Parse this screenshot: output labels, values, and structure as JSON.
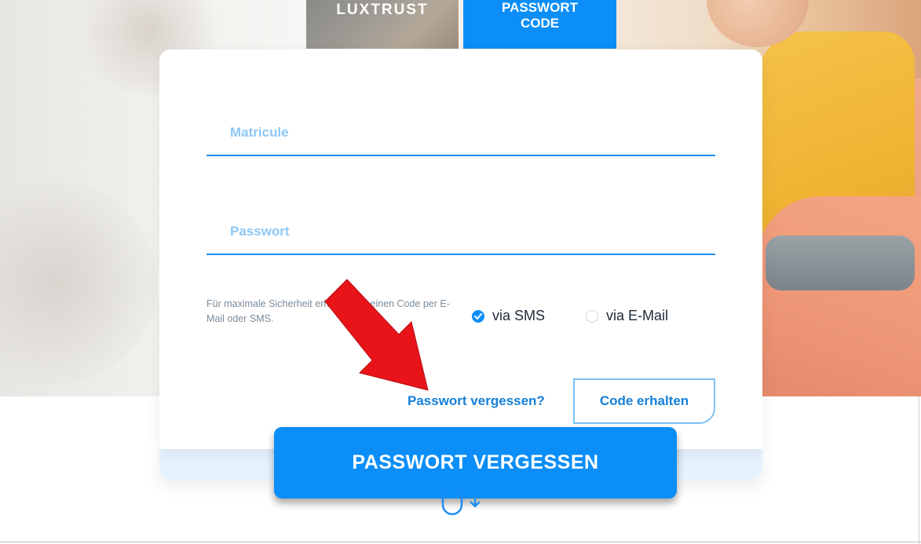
{
  "tabs": {
    "luxtrust_label": "LUXTRUST",
    "passwort_label_line1": "PASSWORT",
    "passwort_label_line2": "CODE"
  },
  "form": {
    "matricule_placeholder": "Matricule",
    "passwort_placeholder": "Passwort",
    "info_text": "Für maximale Sicherheit erhalten Sie einen Code per E-Mail oder SMS.",
    "radio_sms_label": "via SMS",
    "radio_mail_label": "via E-Mail",
    "radio_selected": "via SMS",
    "forgot_link": "Passwort vergessen?",
    "code_button": "Code erhalten"
  },
  "banner": {
    "label": "PASSWORT VERGESSEN"
  },
  "icons": {
    "checked_radio": "checkmark-icon",
    "scroll": "mouse-scroll-icon",
    "annotation": "red-arrow-icon"
  },
  "colors": {
    "primary": "#0b8ef7",
    "link": "#1580d8",
    "annotation": "#e8141a"
  }
}
